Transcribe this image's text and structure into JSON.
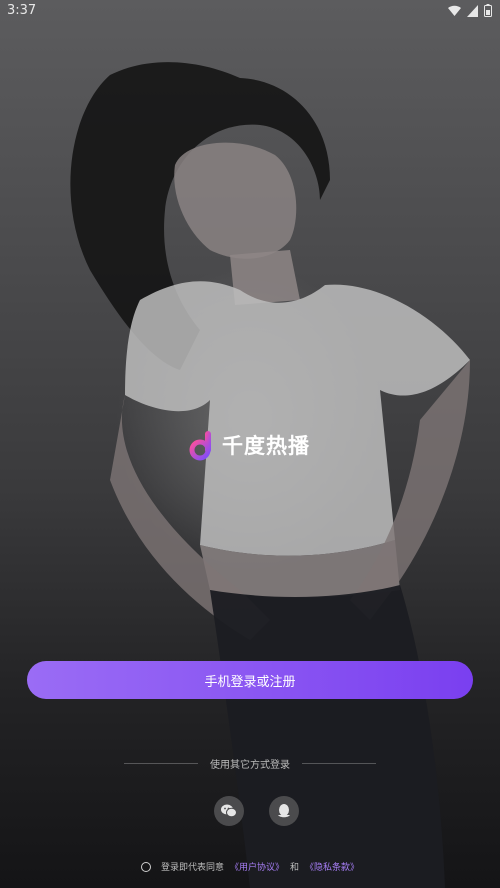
{
  "status_bar": {
    "time": "3:37"
  },
  "app": {
    "name": "千度热播"
  },
  "login": {
    "phone_button_label": "手机登录或注册"
  },
  "alt_login": {
    "divider_text": "使用其它方式登录",
    "methods": [
      {
        "name": "wechat",
        "icon": "wechat-icon"
      },
      {
        "name": "qq",
        "icon": "qq-icon"
      }
    ]
  },
  "agreement": {
    "prefix": "登录即代表同意",
    "user_agreement": "《用户协议》",
    "and": "和",
    "privacy": "《隐私条款》"
  },
  "colors": {
    "accent": "#8b57f2",
    "link": "#a77ef6"
  }
}
